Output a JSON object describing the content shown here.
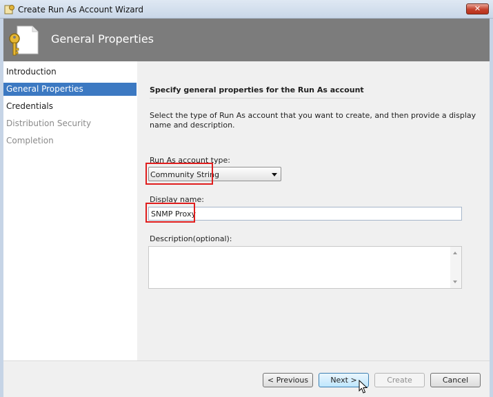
{
  "window": {
    "title": "Create Run As Account Wizard",
    "close_glyph": "✕"
  },
  "header": {
    "title": "General Properties",
    "icon": "key-document-icon"
  },
  "nav": {
    "items": [
      {
        "label": "Introduction",
        "state": "normal"
      },
      {
        "label": "General Properties",
        "state": "active"
      },
      {
        "label": "Credentials",
        "state": "normal"
      },
      {
        "label": "Distribution Security",
        "state": "disabled"
      },
      {
        "label": "Completion",
        "state": "disabled"
      }
    ]
  },
  "main": {
    "section_title": "Specify general properties for the Run As account",
    "description": "Select the type of Run As account that you want to create, and then provide a display name and description.",
    "account_type": {
      "label": "Run As account type:",
      "value": "Community String"
    },
    "display_name": {
      "label": "Display name:",
      "value": "SNMP Proxy"
    },
    "description_field": {
      "label": "Description(optional):",
      "value": ""
    }
  },
  "footer": {
    "previous": "< Previous",
    "next": "Next >",
    "create": "Create",
    "cancel": "Cancel"
  },
  "colors": {
    "nav_active": "#3c79c2",
    "header_band": "#7c7c7c",
    "highlight_box": "#e01d1d"
  }
}
